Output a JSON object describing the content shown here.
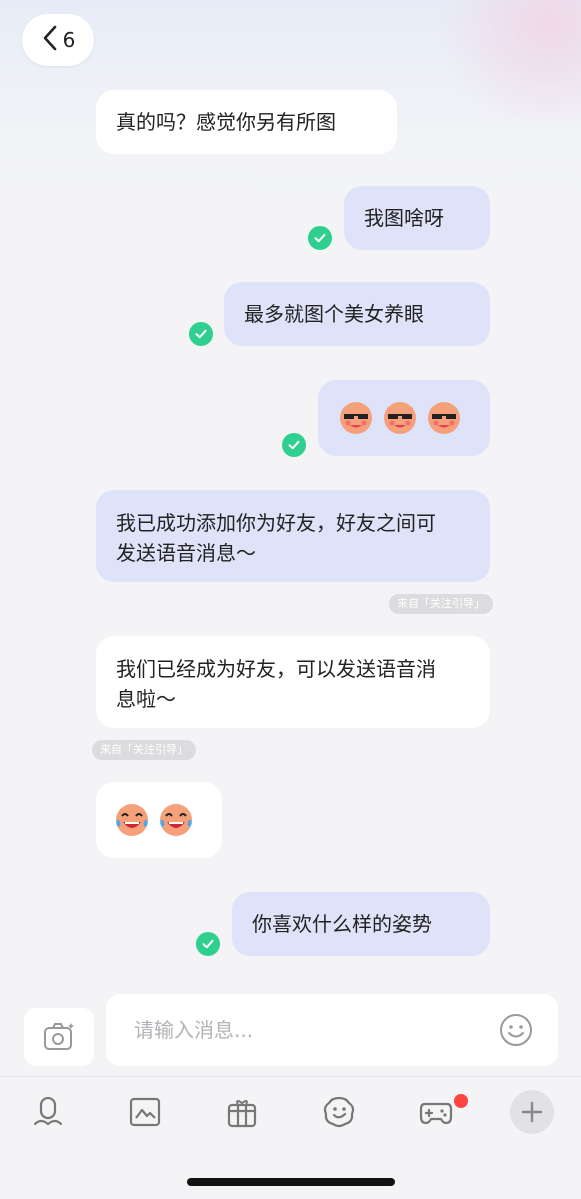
{
  "header": {
    "unread_count": "6"
  },
  "messages": [
    {
      "direction": "in",
      "text": "真的吗？感觉你另有所图"
    },
    {
      "direction": "out",
      "text": "我图啥呀",
      "status": "read"
    },
    {
      "direction": "out",
      "text": "最多就图个美女养眼",
      "status": "read"
    },
    {
      "direction": "out",
      "emoji": [
        "cool-face-emoji",
        "cool-face-emoji",
        "cool-face-emoji"
      ],
      "status": "read"
    },
    {
      "direction": "out",
      "text": "我已成功添加你为好友，好友之间可发送语音消息～",
      "source": "来自「关注引导」"
    },
    {
      "direction": "in",
      "text": "我们已经成为好友，可以发送语音消息啦～",
      "source": "来自「关注引导」"
    },
    {
      "direction": "in",
      "emoji": [
        "laughing-tears-emoji",
        "laughing-tears-emoji"
      ]
    },
    {
      "direction": "out",
      "text": "你喜欢什么样的姿势",
      "status": "read"
    }
  ],
  "composer": {
    "placeholder": "请输入消息..."
  },
  "toolbar": {
    "items": [
      "microphone-icon",
      "image-icon",
      "gift-icon",
      "sticker-icon",
      "game-icon",
      "plus-icon"
    ],
    "game_has_badge": true
  },
  "colors": {
    "accent_green": "#2fcf8f",
    "out_bubble": "#dee3fa",
    "in_bubble": "#ffffff",
    "badge_red": "#ff4242"
  }
}
